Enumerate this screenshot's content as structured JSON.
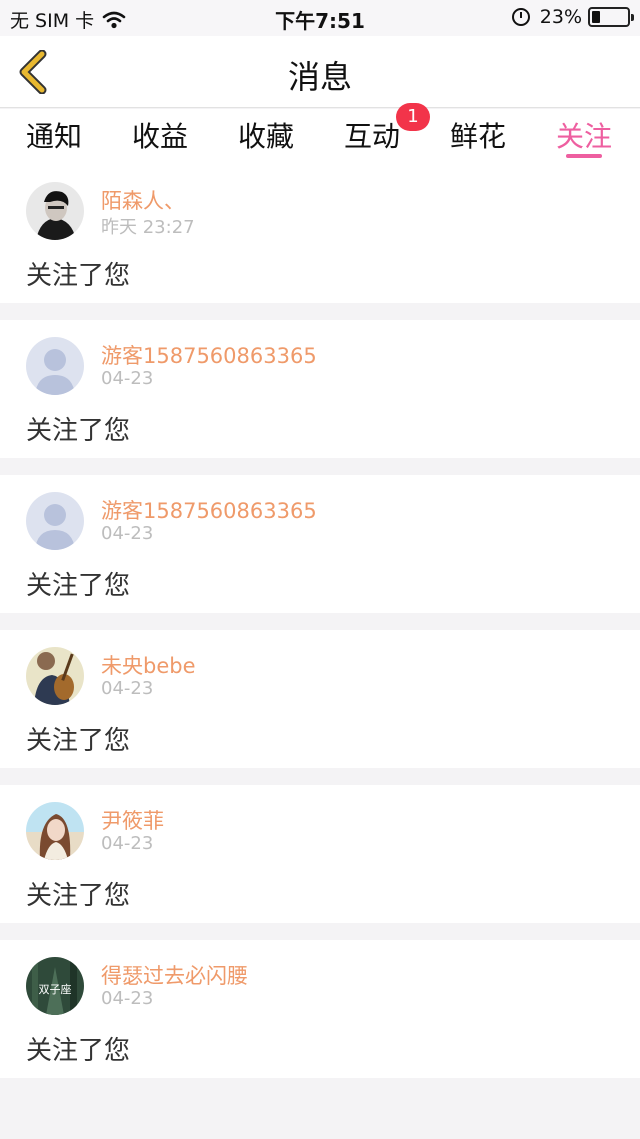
{
  "status_bar": {
    "carrier": "无 SIM 卡",
    "time": "下午7:51",
    "battery_percent": "23%",
    "battery_level": 0.23,
    "icons": [
      "wifi-icon",
      "alarm-icon",
      "battery-icon"
    ]
  },
  "header": {
    "title": "消息",
    "back_icon": "chevron-left-icon"
  },
  "tabs": [
    {
      "label": "通知",
      "active": false
    },
    {
      "label": "收益",
      "active": false
    },
    {
      "label": "收藏",
      "active": false
    },
    {
      "label": "互动",
      "active": false,
      "badge": "1"
    },
    {
      "label": "鲜花",
      "active": false
    },
    {
      "label": "关注",
      "active": true
    }
  ],
  "colors": {
    "accent": "#ee5fa0",
    "name": "#ef9a6a",
    "badge": "#f2344a",
    "back_icon": "#e8b830"
  },
  "notifications": [
    {
      "name": "陌森人、",
      "time": "昨天 23:27",
      "message": "关注了您",
      "avatar": "photo-man"
    },
    {
      "name": "游客1587560863365",
      "time": "04-23",
      "message": "关注了您",
      "avatar": "default-avatar"
    },
    {
      "name": "游客1587560863365",
      "time": "04-23",
      "message": "关注了您",
      "avatar": "default-avatar"
    },
    {
      "name": "未央bebe",
      "time": "04-23",
      "message": "关注了您",
      "avatar": "photo-guitar"
    },
    {
      "name": "尹筱菲",
      "time": "04-23",
      "message": "关注了您",
      "avatar": "photo-woman"
    },
    {
      "name": "得瑟过去必闪腰",
      "time": "04-23",
      "message": "关注了您",
      "avatar": "photo-gemini",
      "avatar_text": "双子座"
    }
  ]
}
